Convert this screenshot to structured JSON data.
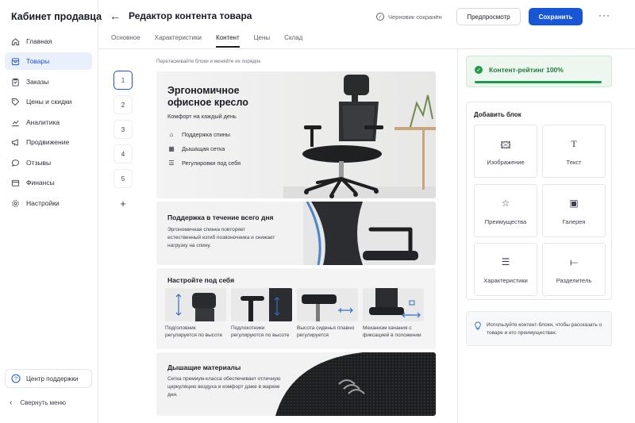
{
  "sidebar": {
    "brand": "Кабинет продавца",
    "items": [
      {
        "label": "Главная",
        "icon": "home-icon"
      },
      {
        "label": "Товары",
        "icon": "box-icon",
        "active": true
      },
      {
        "label": "Заказы",
        "icon": "clipboard-icon"
      },
      {
        "label": "Цены и скидки",
        "icon": "tag-icon"
      },
      {
        "label": "Аналитика",
        "icon": "chart-icon"
      },
      {
        "label": "Продвижение",
        "icon": "megaphone-icon"
      },
      {
        "label": "Отзывы",
        "icon": "chat-icon"
      },
      {
        "label": "Финансы",
        "icon": "wallet-icon"
      },
      {
        "label": "Настройки",
        "icon": "gear-icon"
      }
    ],
    "support_label": "Центр поддержки",
    "collapse_label": "Свернуть меню"
  },
  "header": {
    "title": "Редактор контента товара",
    "draft_status": "Черновик сохранён",
    "preview_label": "Предпросмотр",
    "save_label": "Сохранить",
    "more_label": "···",
    "tabs": [
      {
        "label": "Основное"
      },
      {
        "label": "Характеристики"
      },
      {
        "label": "Контент",
        "active": true
      },
      {
        "label": "Цены"
      },
      {
        "label": "Склад"
      }
    ]
  },
  "editor": {
    "hint": "Перетаскивайте блоки и меняйте их порядок",
    "steps": [
      "1",
      "2",
      "3",
      "4",
      "5"
    ],
    "add_step": "+",
    "hero": {
      "title": "Эргономичное офисное кресло",
      "subtitle": "Комфорт на каждый день",
      "features": [
        "Поддержка спины",
        "Дышащая сетка",
        "Регулировки под себя"
      ]
    },
    "support_block": {
      "title": "Поддержка в течение всего дня",
      "text": "Эргономичная спинка повторяет естественный изгиб позвоночника и снижает нагрузку на спину."
    },
    "adjust_block": {
      "title": "Настройте под себя",
      "items": [
        "Подголовник регулируется по высоте",
        "Подлокотники регулируются по высоте",
        "Высота сиденья плавно регулируется",
        "Механизм качания с фиксацией в положении"
      ]
    },
    "materials_block": {
      "title": "Дышащие материалы",
      "text": "Сетка премиум-класса обеспечивает отличную циркуляцию воздуха и комфорт даже в жаркие дни."
    }
  },
  "panel": {
    "rating_label": "Контент-рейтинг 100%",
    "rating_value": 1.0,
    "add_block_title": "Добавить блок",
    "blocks": [
      {
        "label": "Изображение",
        "icon": "image-icon"
      },
      {
        "label": "Текст",
        "icon": "text-icon"
      },
      {
        "label": "Преимущества",
        "icon": "star-icon"
      },
      {
        "label": "Галерея",
        "icon": "gallery-icon"
      },
      {
        "label": "Характеристики",
        "icon": "list-icon"
      },
      {
        "label": "Разделитель",
        "icon": "divider-icon"
      }
    ],
    "tip": "Используйте контент-блоки, чтобы рассказать о товаре и его преимуществах."
  },
  "colors": {
    "accent": "#1757d6",
    "success": "#1e9b48",
    "active_bg": "#e9effb"
  }
}
